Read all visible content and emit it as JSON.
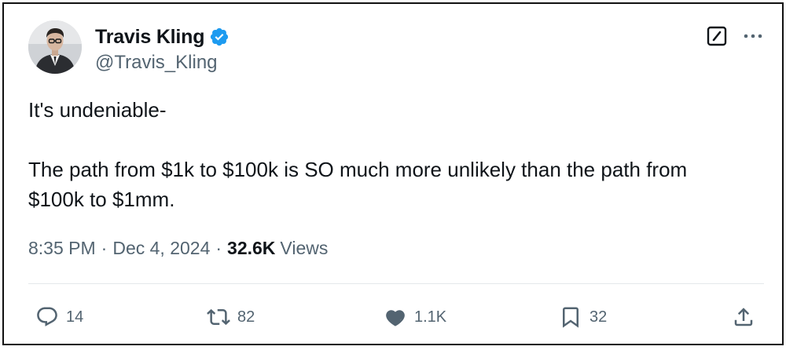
{
  "author": {
    "display_name": "Travis Kling",
    "handle": "@Travis_Kling",
    "verified": true
  },
  "tweet": {
    "lines": [
      "It's undeniable-",
      "",
      "The path from $1k to $100k is SO much more unlikely than the path from",
      "$100k to $1mm."
    ]
  },
  "meta": {
    "time": "8:35 PM",
    "separator": "·",
    "date": "Dec 4, 2024",
    "views_count": "32.6K",
    "views_label": "Views"
  },
  "actions": {
    "replies": "14",
    "retweets": "82",
    "likes": "1.1K",
    "bookmarks": "32"
  },
  "colors": {
    "verified_badge": "#1d9bf0",
    "text_primary": "#0f1419",
    "text_secondary": "#536471",
    "divider": "#e4e8eb"
  },
  "icons": [
    "avatar",
    "verified-badge-icon",
    "grok-icon",
    "more-icon",
    "reply-icon",
    "retweet-icon",
    "like-icon",
    "bookmark-icon",
    "share-icon"
  ]
}
